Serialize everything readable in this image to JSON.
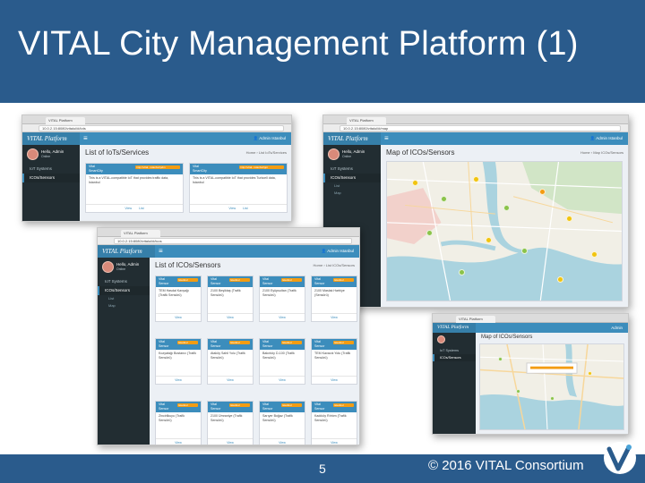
{
  "slide": {
    "title": "VITAL City Management Platform (1)",
    "page_number": "5",
    "copyright": "© 2016 VITAL Consortium"
  },
  "colors": {
    "slide_blue": "#2a5b8c",
    "app_header": "#3c8dbc",
    "app_sidebar": "#222d32",
    "accent_orange": "#f39c12",
    "map_water": "#aad3df",
    "map_land": "#f1efe6"
  },
  "screenshots": {
    "iots": {
      "tab_label": "VITAL Platform",
      "url": "10.0.2.15:8080/vitalui/#/iots",
      "brand": "VITAL Platform",
      "user_label": "Admin Istanbul",
      "profile_name": "Hello, Admin",
      "profile_status": "Online",
      "menu": [
        "IoT Systems",
        "ICOs/Sensors"
      ],
      "page_title": "List of IoTs/Services",
      "breadcrumb": "Home › List IoTs/Services",
      "cards": [
        {
          "head": "Vital\nSmartCity",
          "tag": "http://vital...istanbul/pdm",
          "body": "This is a VITAL-compatible IoT that provides traffic data, Istanbul",
          "view": "View",
          "list": "List"
        },
        {
          "head": "Vital\nSmartCity",
          "tag": "http://vital...istanbul/ppi",
          "body": "This is a VITAL-compatible IoT that provides Turkcell data, Istanbul",
          "view": "View",
          "list": "List"
        }
      ]
    },
    "icos": {
      "tab_label": "VITAL Platform",
      "url": "10.0.2.15:8080/vitalui/#/icos",
      "brand": "VITAL Platform",
      "user_label": "Admin Istanbul",
      "profile_name": "Hello, Admin",
      "profile_status": "Online",
      "menu": [
        "IoT Systems",
        "ICOs/Sensors"
      ],
      "submenu": [
        "List",
        "Map"
      ],
      "page_title": "List of ICOs/Sensors",
      "breadcrumb": "Home › List ICOs/Sensors",
      "cards": [
        {
          "head": "Vital\nSensor",
          "tag": "Istanbul",
          "body": "TEM Hasdal Kavşağı (Trafik Sensörü)",
          "view": "View"
        },
        {
          "head": "Vital\nSensor",
          "tag": "Istanbul",
          "body": "2100 Beşiktaş (Trafik Sensörü)",
          "view": "View"
        },
        {
          "head": "Vital\nSensor",
          "tag": "Istanbul",
          "body": "2100 Eyüpsultan (Trafik Sensörü)",
          "view": "View"
        },
        {
          "head": "Vital\nSensor",
          "tag": "Istanbul",
          "body": "2100 Maslak Harbiye (Sensörü)",
          "view": "View"
        },
        {
          "head": "Vital\nSensor",
          "tag": "Istanbul",
          "body": "Kozyatağı Bostancı (Trafik Sensörü)",
          "view": "View"
        },
        {
          "head": "Vital\nSensor",
          "tag": "Istanbul",
          "body": "Ataköy Sahil Yolu (Trafik Sensörü)",
          "view": "View"
        },
        {
          "head": "Vital\nSensor",
          "tag": "Istanbul",
          "body": "Bakırköy D-100 (Trafik Sensörü)",
          "view": "View"
        },
        {
          "head": "Vital\nSensor",
          "tag": "Istanbul",
          "body": "TEM Kavacık Yolu (Trafik Sensörü)",
          "view": "View"
        },
        {
          "head": "Vital\nSensor",
          "tag": "Istanbul",
          "body": "Zincirlikuyu (Trafik Sensörü)",
          "view": "View"
        },
        {
          "head": "Vital\nSensor",
          "tag": "Istanbul",
          "body": "2100 Ümraniye (Trafik Sensörü)",
          "view": "View"
        },
        {
          "head": "Vital\nSensor",
          "tag": "Istanbul",
          "body": "Sarıyer Boğaz (Trafik Sensörü)",
          "view": "View"
        },
        {
          "head": "Vital\nSensor",
          "tag": "Istanbul",
          "body": "Kadıköy Rıhtım (Trafik Sensörü)",
          "view": "View"
        }
      ]
    },
    "map": {
      "tab_label": "VITAL Platform",
      "url": "10.0.2.15:8080/vitalui/#/map",
      "brand": "VITAL Platform",
      "user_label": "Admin Istanbul",
      "profile_name": "Hello, Admin",
      "profile_status": "Online",
      "menu": [
        "IoT Systems",
        "ICOs/Sensors"
      ],
      "submenu": [
        "List",
        "Map"
      ],
      "page_title": "Map of ICOs/Sensors",
      "breadcrumb": "Home › Map ICOs/Sensors"
    },
    "map_small": {
      "tab_label": "VITAL Platform",
      "brand": "VITAL Platform",
      "page_title": "Map of ICOs/Sensors",
      "user_label": "Admin",
      "menu": [
        "IoT Systems",
        "ICOs/Sensors"
      ]
    }
  },
  "icons": [
    "vital-logo-icon",
    "hamburger-icon",
    "user-icon",
    "map-cluster-icon"
  ]
}
